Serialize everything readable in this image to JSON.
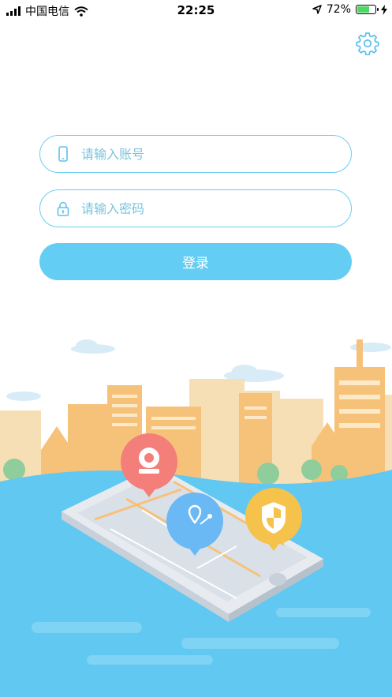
{
  "status_bar": {
    "carrier": "中国电信",
    "time": "22:25",
    "battery_percent": "72%",
    "battery_level": 0.72
  },
  "login": {
    "account_placeholder": "请输入账号",
    "password_placeholder": "请输入密码",
    "submit_label": "登录"
  },
  "icons": {
    "settings": "gear-icon",
    "account": "phone-icon",
    "password": "lock-icon"
  },
  "colors": {
    "accent": "#63cdf4",
    "field_border": "#6ccdf0",
    "placeholder": "#7cc3de"
  }
}
